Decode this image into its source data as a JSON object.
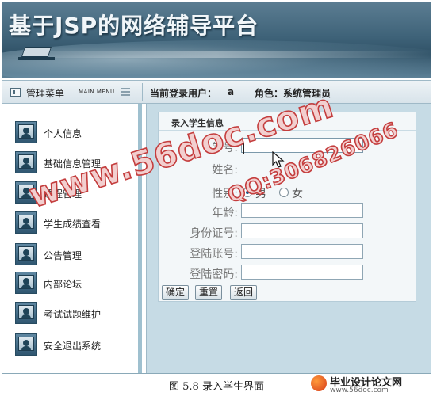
{
  "header": {
    "title": "基于JSP的网络辅导平台"
  },
  "toolbar": {
    "menu_label": "管理菜单",
    "menu_en": "MAIN MENU",
    "current_user_label": "当前登录用户：",
    "current_user_value": "a",
    "role_label": "角色：系统管理员"
  },
  "sidebar": {
    "items": [
      {
        "label": "个人信息"
      },
      {
        "label": "基础信息管理"
      },
      {
        "label": "课程管理"
      },
      {
        "label": "学生成绩查看"
      },
      {
        "label": "公告管理"
      },
      {
        "label": "内部论坛"
      },
      {
        "label": "考试试题维护"
      },
      {
        "label": "安全退出系统"
      }
    ]
  },
  "form": {
    "title": "录入学生信息",
    "fields": {
      "student_id": {
        "label": "学号:",
        "value": ""
      },
      "name": {
        "label": "姓名:",
        "value": ""
      },
      "gender": {
        "label": "性别:",
        "options": [
          "男",
          "女"
        ],
        "selected": "男"
      },
      "age": {
        "label": "年龄:",
        "value": ""
      },
      "id_card": {
        "label": "身份证号:",
        "value": ""
      },
      "login_account": {
        "label": "登陆账号:",
        "value": ""
      },
      "login_password": {
        "label": "登陆密码:",
        "value": ""
      }
    },
    "buttons": {
      "confirm": "确定",
      "reset": "重置",
      "back": "返回"
    }
  },
  "watermark": {
    "site": "www.56doc.com",
    "qq": "QQ:306826066"
  },
  "caption": "图 5.8 录入学生界面",
  "footer": {
    "brand": "毕业设计论文网",
    "url": "www.56doc.com"
  }
}
